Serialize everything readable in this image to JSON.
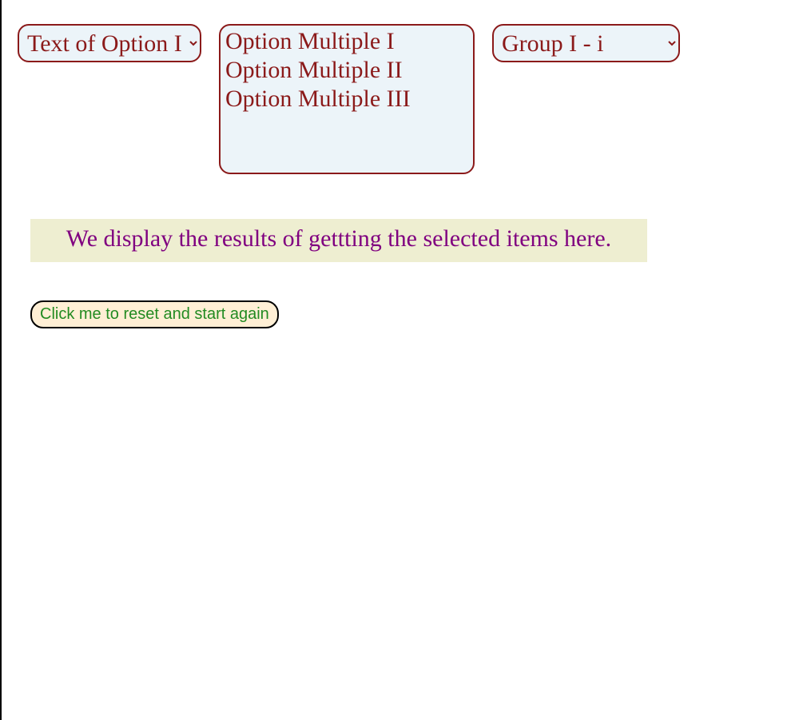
{
  "selects": {
    "single1": {
      "selected": "Text of Option I"
    },
    "multi": {
      "options": [
        "Option Multiple I",
        "Option Multiple II",
        "Option Multiple III"
      ]
    },
    "single3": {
      "selected": "Group I - i"
    }
  },
  "results": {
    "text": "We display the results of gettting the selected items here."
  },
  "button": {
    "reset_label": "Click me to reset and start again"
  }
}
